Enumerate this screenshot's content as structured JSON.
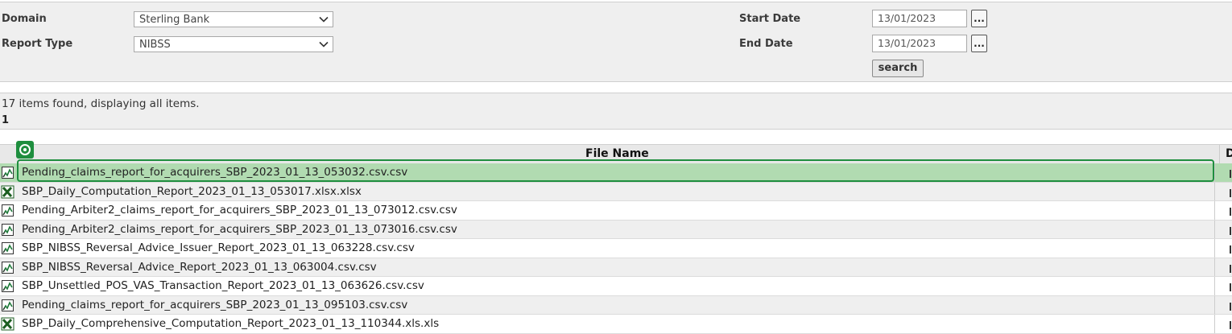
{
  "filters": {
    "domain": {
      "label": "Domain",
      "value": "Sterling Bank"
    },
    "report_type": {
      "label": "Report Type",
      "value": "NIBSS"
    },
    "start_date": {
      "label": "Start Date",
      "value": "13/01/2023"
    },
    "end_date": {
      "label": "End Date",
      "value": "13/01/2023"
    },
    "date_picker_label": "...",
    "search_label": "search"
  },
  "results": {
    "summary": "17 items found, displaying all items.",
    "page": "1"
  },
  "table": {
    "columns": [
      "File Name",
      "D"
    ],
    "rows": [
      {
        "file_name": "Pending_claims_report_for_acquirers_SBP_2023_01_13_053032.csv.csv",
        "icon": "csv-file-icon"
      },
      {
        "file_name": "SBP_Daily_Computation_Report_2023_01_13_053017.xlsx.xlsx",
        "icon": "excel-file-icon"
      },
      {
        "file_name": "Pending_Arbiter2_claims_report_for_acquirers_SBP_2023_01_13_073012.csv.csv",
        "icon": "csv-file-icon"
      },
      {
        "file_name": "Pending_Arbiter2_claims_report_for_acquirers_SBP_2023_01_13_073016.csv.csv",
        "icon": "csv-file-icon"
      },
      {
        "file_name": "SBP_NIBSS_Reversal_Advice_Issuer_Report_2023_01_13_063228.csv.csv",
        "icon": "csv-file-icon"
      },
      {
        "file_name": "SBP_NIBSS_Reversal_Advice_Report_2023_01_13_063004.csv.csv",
        "icon": "csv-file-icon"
      },
      {
        "file_name": "SBP_Unsettled_POS_VAS_Transaction_Report_2023_01_13_063626.csv.csv",
        "icon": "csv-file-icon"
      },
      {
        "file_name": "Pending_claims_report_for_acquirers_SBP_2023_01_13_095103.csv.csv",
        "icon": "csv-file-icon"
      },
      {
        "file_name": "SBP_Daily_Comprehensive_Computation_Report_2023_01_13_110344.xls.xls",
        "icon": "excel-file-icon"
      }
    ],
    "selected_index": 0
  },
  "colors": {
    "selection": "#b1dbb1",
    "selection_border": "#1e8e3e",
    "panel": "#efefef"
  }
}
